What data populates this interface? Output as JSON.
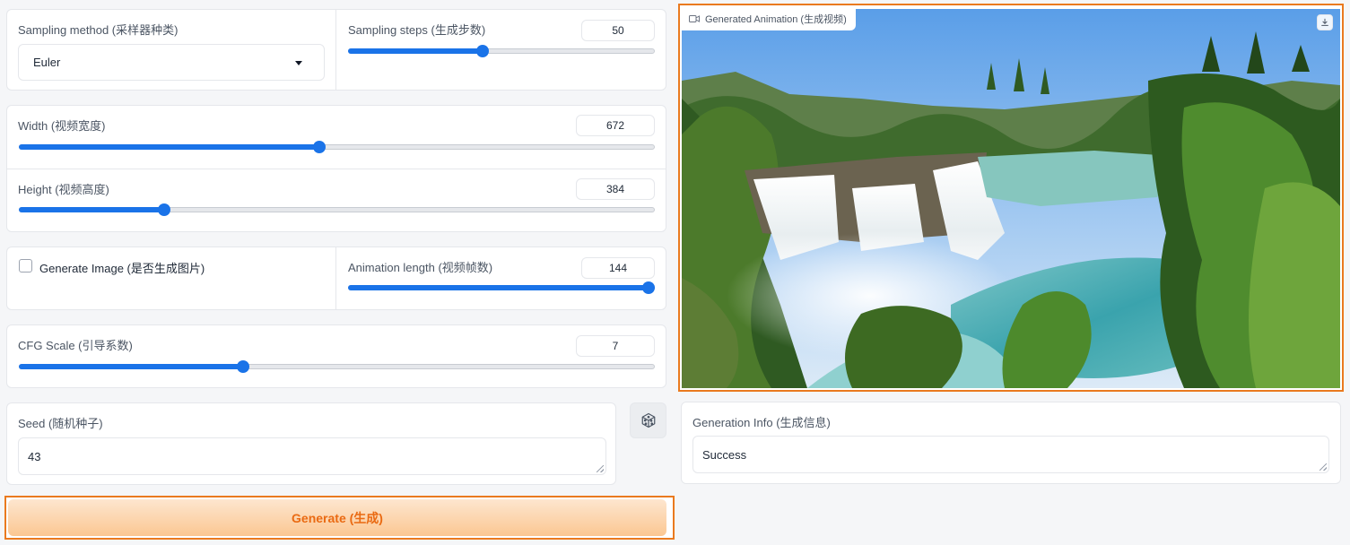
{
  "sampling": {
    "method_label": "Sampling method (采样器种类)",
    "method_value": "Euler",
    "steps_label": "Sampling steps (生成步数)",
    "steps_value": "50",
    "steps_fraction": 0.44
  },
  "size": {
    "width_label": "Width (视频宽度)",
    "width_value": "672",
    "width_fraction": 0.473,
    "height_label": "Height (视频高度)",
    "height_value": "384",
    "height_fraction": 0.228
  },
  "generate_image": {
    "label": "Generate Image (是否生成图片)",
    "checked": false
  },
  "animation": {
    "label": "Animation length (视频帧数)",
    "value": "144",
    "fraction": 1.0
  },
  "cfg": {
    "label": "CFG Scale (引导系数)",
    "value": "7",
    "fraction": 0.352
  },
  "seed": {
    "label": "Seed (随机种子)",
    "value": "43",
    "dice_icon": "dice-icon"
  },
  "generate_button": {
    "label": "Generate (生成)"
  },
  "output": {
    "video_label": "Generated Animation (生成视频)",
    "video_icon": "video-camera-icon",
    "download_icon": "download-icon",
    "info_label": "Generation Info (生成信息)",
    "info_value": "Success"
  },
  "colors": {
    "accent": "#1a73e8",
    "highlight": "#ea7a1f",
    "generate_text": "#ea6a12"
  }
}
